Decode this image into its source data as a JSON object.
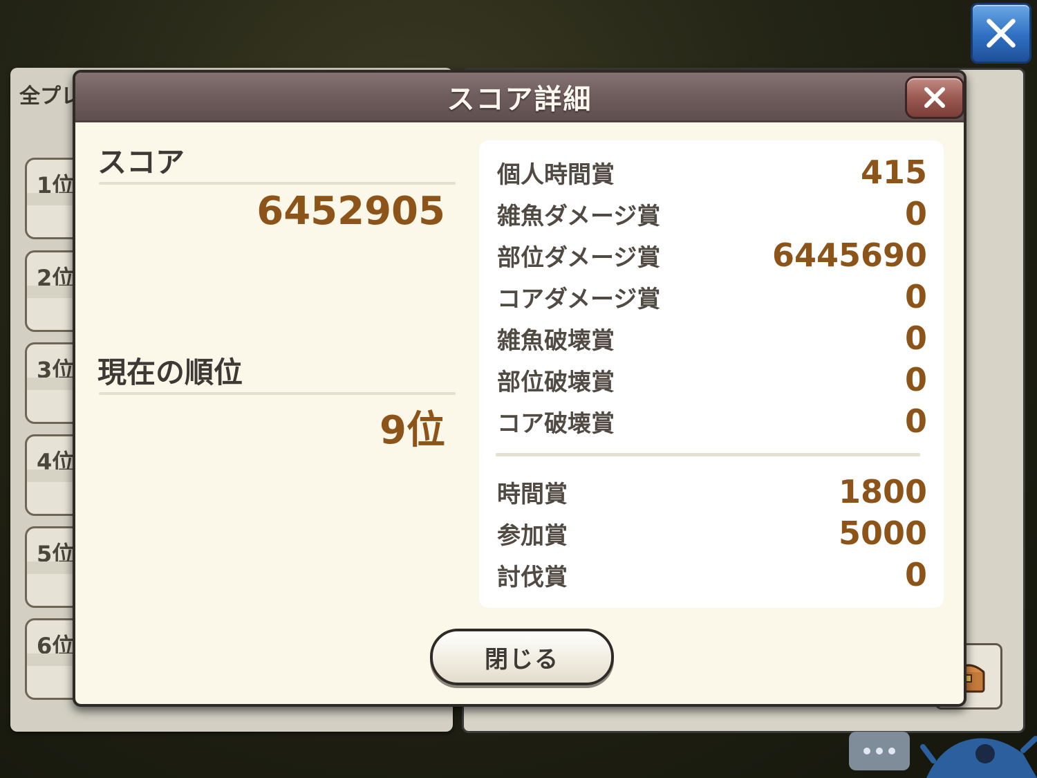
{
  "background": {
    "tab_label": "全プレ",
    "rank_cards": [
      "1位",
      "2位",
      "3位",
      "4位",
      "5位",
      "6位"
    ]
  },
  "modal": {
    "title": "スコア詳細",
    "score_label": "スコア",
    "score_value": "6452905",
    "rank_label": "現在の順位",
    "rank_value": "9位",
    "breakdown_top": [
      {
        "label": "個人時間賞",
        "value": "415"
      },
      {
        "label": "雑魚ダメージ賞",
        "value": "0"
      },
      {
        "label": "部位ダメージ賞",
        "value": "6445690"
      },
      {
        "label": "コアダメージ賞",
        "value": "0"
      },
      {
        "label": "雑魚破壊賞",
        "value": "0"
      },
      {
        "label": "部位破壊賞",
        "value": "0"
      },
      {
        "label": "コア破壊賞",
        "value": "0"
      }
    ],
    "breakdown_bottom": [
      {
        "label": "時間賞",
        "value": "1800"
      },
      {
        "label": "参加賞",
        "value": "5000"
      },
      {
        "label": "討伐賞",
        "value": "0"
      }
    ],
    "close_button_label": "閉じる"
  },
  "icons": {
    "top_close": "close-icon",
    "modal_close": "close-icon",
    "chest": "treasure-chest-icon",
    "chat": "chat-bubble-icon"
  },
  "colors": {
    "value_brown": "#8c5418",
    "header_mauve": "#6e5d5c",
    "panel_cream": "#fbf8ea",
    "blue_button": "#2f6fc2"
  }
}
